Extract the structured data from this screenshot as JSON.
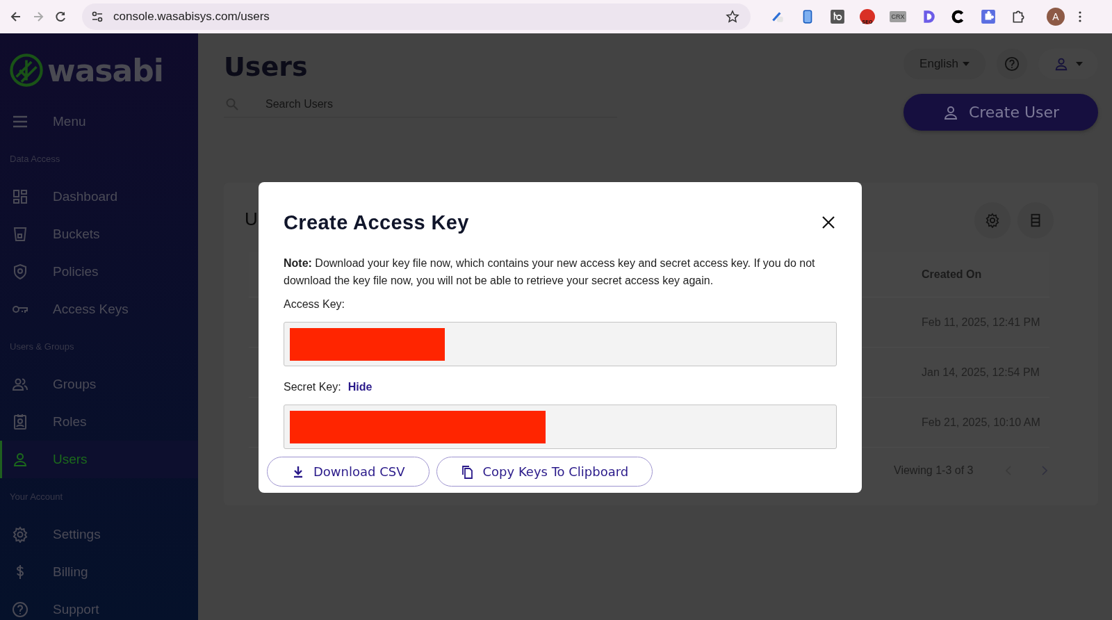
{
  "browser": {
    "url": "console.wasabisys.com/users",
    "avatar": "A",
    "extensions": [
      {
        "kind": "pen"
      },
      {
        "kind": "phone"
      },
      {
        "kind": "hub"
      },
      {
        "kind": "seo",
        "label": "SEO"
      },
      {
        "kind": "crx",
        "label": "CRX"
      },
      {
        "kind": "dlogo"
      },
      {
        "kind": "clogo"
      },
      {
        "kind": "puzzle-blue"
      },
      {
        "kind": "puzzle"
      }
    ]
  },
  "sidebar": {
    "logo": "wasabi",
    "menu_label": "Menu",
    "sections": [
      {
        "title": "Data Access",
        "items": [
          {
            "label": "Dashboard",
            "kind": "dashboard",
            "selected": false
          },
          {
            "label": "Buckets",
            "kind": "bucket",
            "selected": false
          },
          {
            "label": "Policies",
            "kind": "shield",
            "selected": false
          },
          {
            "label": "Access Keys",
            "kind": "key",
            "selected": false
          }
        ]
      },
      {
        "title": "Users & Groups",
        "items": [
          {
            "label": "Groups",
            "kind": "group",
            "selected": false
          },
          {
            "label": "Roles",
            "kind": "badge",
            "selected": false
          },
          {
            "label": "Users",
            "kind": "user",
            "selected": true
          }
        ]
      },
      {
        "title": "Your Account",
        "items": [
          {
            "label": "Settings",
            "kind": "gear",
            "selected": false
          },
          {
            "label": "Billing",
            "kind": "dollar",
            "selected": false
          },
          {
            "label": "Support",
            "kind": "help",
            "selected": false
          }
        ]
      }
    ]
  },
  "header": {
    "title": "Users",
    "search": {
      "placeholder": "Search Users"
    },
    "language": "English",
    "create_button": "Create User"
  },
  "card": {
    "title": "U",
    "column": "Created On",
    "rows": [
      {
        "created_on": "Feb 11, 2025, 12:41 PM"
      },
      {
        "created_on": "Jan 14, 2025, 12:54 PM"
      },
      {
        "created_on": "Feb 21, 2025, 10:10 AM"
      }
    ],
    "pagination": "Viewing 1-3 of 3"
  },
  "dialog": {
    "title": "Create Access Key",
    "note": "**Note:** Download your key file now, which contains your new access key and secret access key. If you do not download the key file now, you will not be able to retrieve your secret access key again.",
    "fields": [
      {
        "label": "Access Key:",
        "redacted": true
      },
      {
        "label": "Secret Key:",
        "toggle": "Hide",
        "redacted": true
      }
    ],
    "buttons": [
      {
        "label": "Download CSV",
        "kind": "download"
      },
      {
        "label": "Copy Keys To Clipboard",
        "kind": "copy"
      }
    ]
  }
}
